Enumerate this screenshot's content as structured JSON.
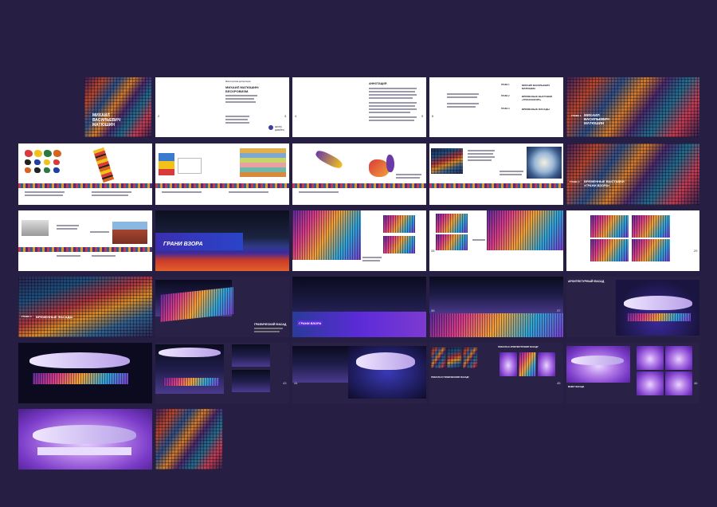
{
  "cover": {
    "name_line1": "МИХАИЛ",
    "name_line2": "ВАСИЛЬЕВИЧ",
    "name_line3": "МАТЮШИН"
  },
  "title_page": {
    "small": "Магистерская диссертация",
    "heading_line1": "МИХАИЛ МАТЮШИН:",
    "heading_line2": "БЕСКРОВИЗМ.",
    "logo_text": "ШКОЛА ДИЗАЙНА",
    "page_left": "2",
    "page_right": "3"
  },
  "annotation_page": {
    "heading": "АННОТАЦИЯ",
    "page_left": "4",
    "page_right": "5"
  },
  "contents_page": {
    "items": [
      {
        "label": "ГЛАВА 1",
        "heading": "МИХАИЛ ВАСИЛЬЕВИЧ МАТЮШИН"
      },
      {
        "label": "ГЛАВА 2",
        "heading": "ВРЕМЕННЫЕ ВЫСТАВКИ «ГРАНИ ВЗОРА»"
      },
      {
        "label": "ГЛАВА 3",
        "heading": "ВРЕМЕННЫЕ ФАСАДЫ"
      }
    ],
    "page_left": "6"
  },
  "chapter1": {
    "label": "ГЛАВА 1",
    "title_line1": "МИХАИЛ",
    "title_line2": "ВАСИЛЬЕВИЧ",
    "title_line3": "МАТЮШИН"
  },
  "chapter2": {
    "label": "ГЛАВА 2",
    "title_line1": "ВРЕМЕННЫЕ ВЫСТАВКИ",
    "title_line2": "«ГРАНИ ВЗОРА»"
  },
  "exhibit": {
    "sign": "ГРАНИ ВЗОРА"
  },
  "chapter3": {
    "label": "ГЛАВА 3",
    "title": "ВРЕМЕННЫЕ ФАСАДЫ"
  },
  "facades": {
    "graphic_title": "ГРАФИЧЕСКИЙ ФАСАД",
    "building_sign": "ГРАНИ ВЗОРА",
    "architectural_title": "АРХИТЕКТУРНЫЙ ФАСАД",
    "posters_architectural": "ПЛАКАТЫ К АРХИТЕКТУРНОМУ ФАСАДУ",
    "posters_graphic": "ПЛАКАТЫ К ГРАФИЧЕСКОМУ ФАСАДУ",
    "light_facade": "МАКЕТ ФАСАДА"
  },
  "page_numbers": {
    "p2_left": "22",
    "p2_right": "23",
    "p3_right": "29",
    "p3_left2": "28",
    "p4_left": "36",
    "p4_right": "37",
    "p5_right": "43",
    "p5_left": "44",
    "p5_right2": "45",
    "p5_right3": "46"
  },
  "colors": {
    "background": "#261e43",
    "accent": "#5b2bd8",
    "sign_bg": "#5b2bd8"
  }
}
